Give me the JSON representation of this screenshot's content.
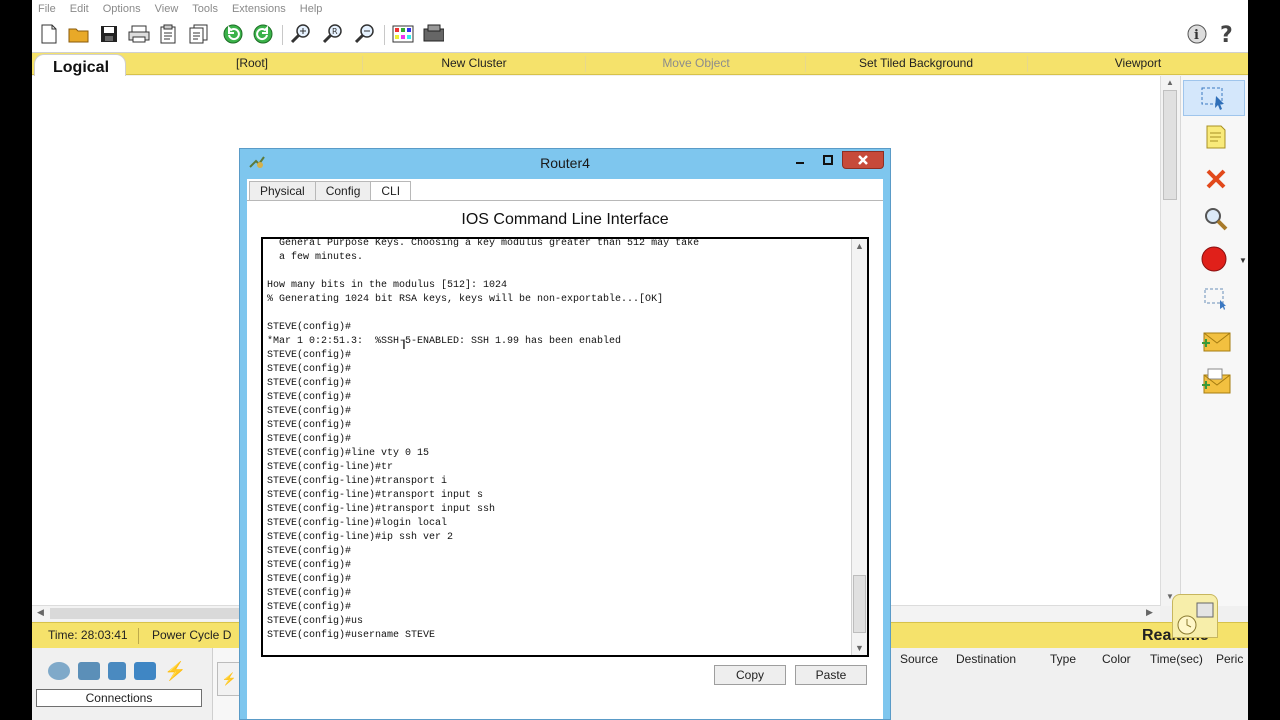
{
  "menu": [
    "File",
    "Edit",
    "Options",
    "View",
    "Tools",
    "Extensions",
    "Help"
  ],
  "logicalbar": {
    "tab": "Logical",
    "items": [
      "[Root]",
      "New Cluster",
      "Move Object",
      "Set Tiled Background",
      "Viewport"
    ]
  },
  "status": {
    "time": "Time: 28:03:41",
    "power": "Power Cycle D",
    "mode": "Realtime"
  },
  "bottom": {
    "connections_label": "Connections",
    "pdu_columns": [
      "Source",
      "Destination",
      "Type",
      "Color",
      "Time(sec)",
      "Peric"
    ]
  },
  "router_window": {
    "title": "Router4",
    "tabs": [
      "Physical",
      "Config",
      "CLI"
    ],
    "heading": "IOS Command Line Interface",
    "terminal_lines": [
      "  General Purpose Keys. Choosing a key modulus greater than 512 may take",
      "  a few minutes.",
      "",
      "How many bits in the modulus [512]: 1024",
      "% Generating 1024 bit RSA keys, keys will be non-exportable...[OK]",
      "",
      "STEVE(config)#",
      "*Mar 1 0:2:51.3:  %SSH-5-ENABLED: SSH 1.99 has been enabled",
      "STEVE(config)#",
      "STEVE(config)#",
      "STEVE(config)#",
      "STEVE(config)#",
      "STEVE(config)#",
      "STEVE(config)#",
      "STEVE(config)#",
      "STEVE(config)#line vty 0 15",
      "STEVE(config-line)#tr",
      "STEVE(config-line)#transport i",
      "STEVE(config-line)#transport input s",
      "STEVE(config-line)#transport input ssh",
      "STEVE(config-line)#login local",
      "STEVE(config-line)#ip ssh ver 2",
      "STEVE(config)#",
      "STEVE(config)#",
      "STEVE(config)#",
      "STEVE(config)#",
      "STEVE(config)#",
      "STEVE(config)#us",
      "STEVE(config)#username STEVE"
    ],
    "copy_label": "Copy",
    "paste_label": "Paste"
  },
  "colors": {
    "yellow_bar": "#f5e26b",
    "window_frame": "#7ec6ee",
    "close_red": "#c74a3a"
  }
}
